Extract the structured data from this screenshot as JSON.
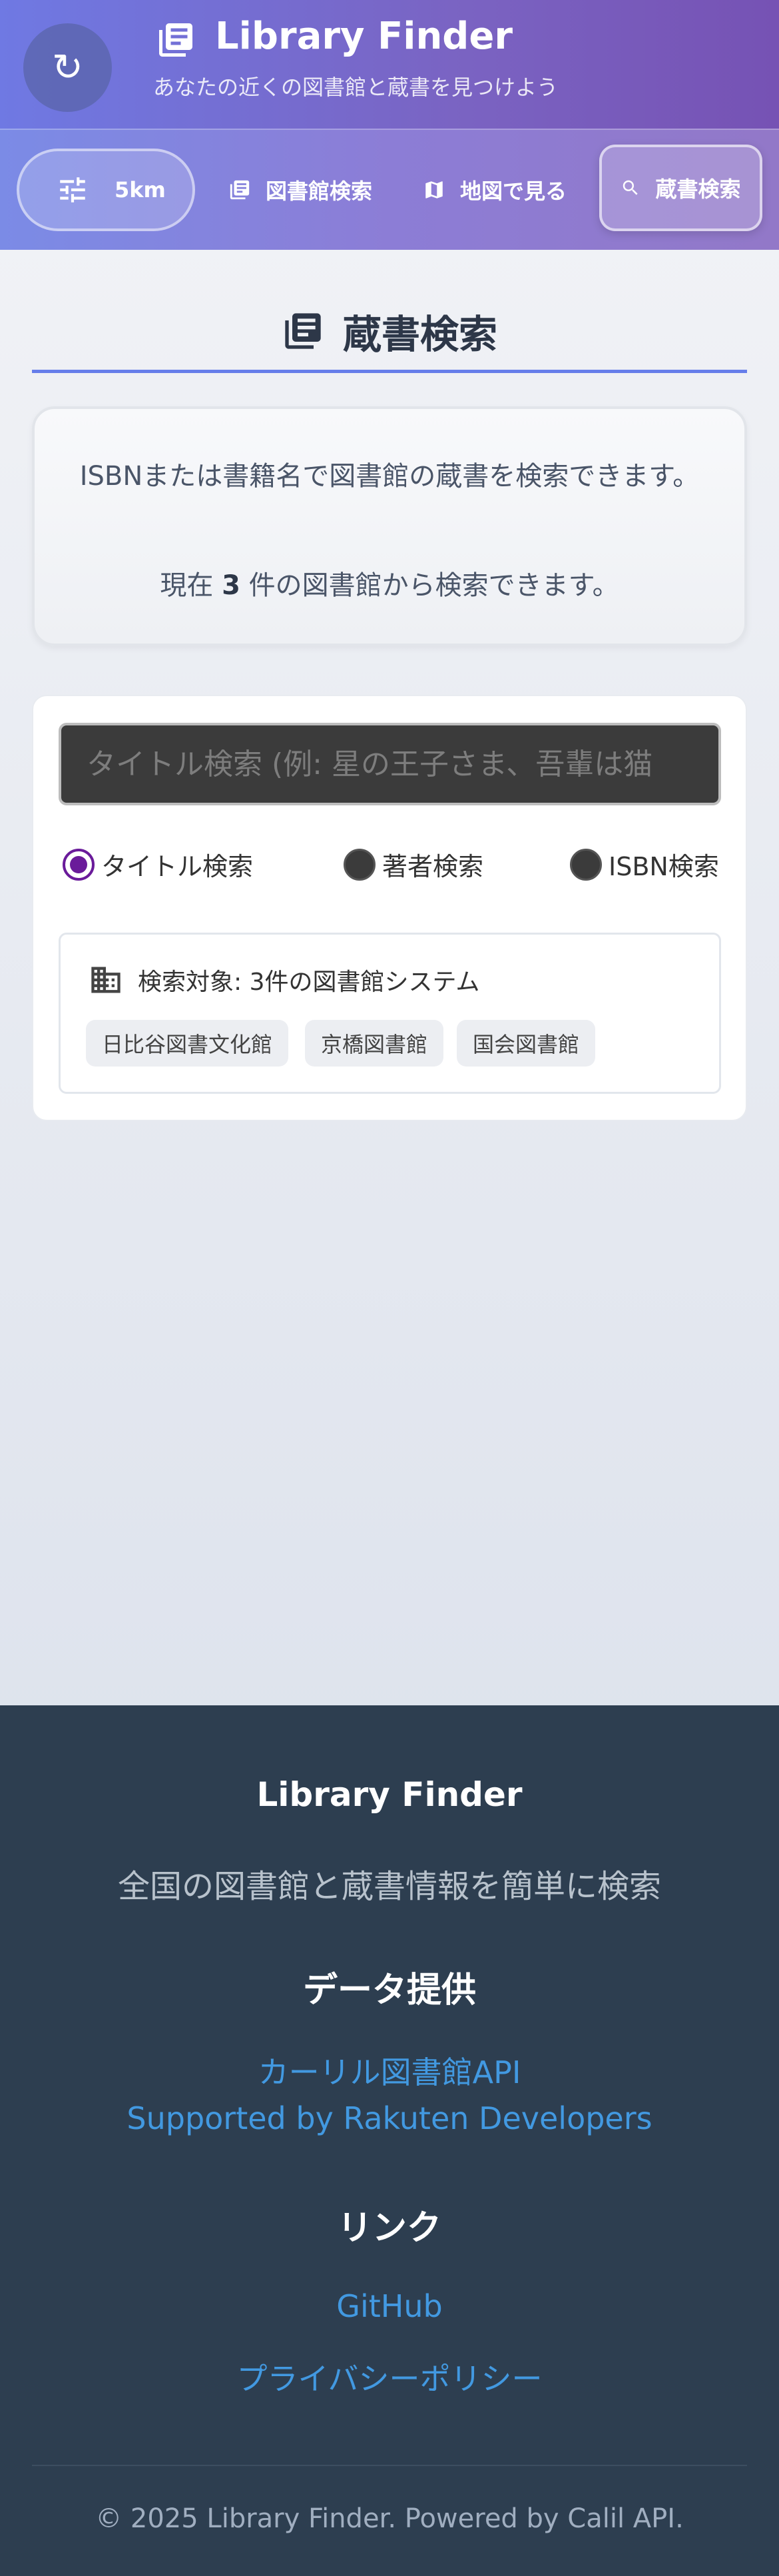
{
  "header": {
    "refresh_icon": "refresh-icon",
    "title": "Library Finder",
    "subtitle": "あなたの近くの図書館と蔵書を見つけよう"
  },
  "nav": {
    "radius_value": "5km",
    "library_search": "図書館検索",
    "map_view": "地図で見る",
    "book_search": "蔵書検索"
  },
  "section": {
    "title": "蔵書検索"
  },
  "info": {
    "line1": "ISBNまたは書籍名で図書館の蔵書を検索できます。",
    "line2_prefix": "現在 ",
    "line2_count": "3",
    "line2_suffix": " 件の図書館から検索できます。"
  },
  "search": {
    "placeholder": "タイトル検索 (例: 星の王子さま、吾輩は猫",
    "modes": [
      {
        "label": "タイトル検索",
        "selected": true
      },
      {
        "label": "著者検索",
        "selected": false
      },
      {
        "label": "ISBN検索",
        "selected": false
      }
    ],
    "target_label": "検索対象: 3件の図書館システム",
    "libraries": [
      "日比谷図書文化館",
      "京橋図書館",
      "国会図書館"
    ]
  },
  "footer": {
    "title": "Library Finder",
    "description": "全国の図書館と蔵書情報を簡単に検索",
    "data_heading": "データ提供",
    "data_links": [
      "カーリル図書館API",
      "Supported by Rakuten Developers"
    ],
    "links_heading": "リンク",
    "links": [
      "GitHub",
      "プライバシーポリシー"
    ],
    "copyright": "© 2025 Library Finder. Powered by Calil API."
  },
  "colors": {
    "header_gradient_start": "#6f79e3",
    "header_gradient_end": "#7652b4",
    "accent": "#667eea",
    "footer_bg": "#2d3e50",
    "link": "#4299e1",
    "radio_selected": "#6a1b9a"
  }
}
